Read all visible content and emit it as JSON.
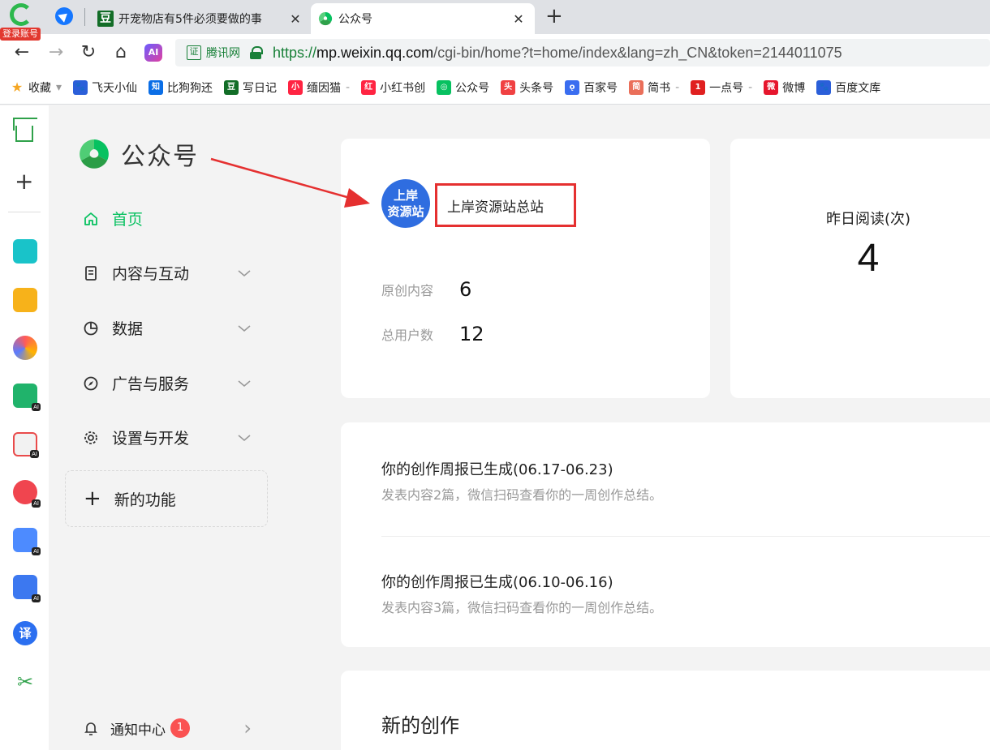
{
  "browser": {
    "brand_badge": "登录账号",
    "tabs": [
      {
        "title": "开宠物店有5件必须要做的事",
        "close": "✕",
        "favicon": "豆"
      },
      {
        "title": "公众号",
        "close": "✕"
      }
    ],
    "new_tab": "+",
    "nav": {
      "back": "←",
      "forward": "→",
      "reload": "↻",
      "home": "⌂",
      "ai": "AI"
    },
    "address": {
      "cert_icon": "证",
      "cert_label": "腾讯网",
      "scheme": "https://",
      "host": "mp.weixin.qq.com",
      "path": "/cgi-bin/home?t=home/index&lang=zh_CN&token=2144011075"
    },
    "bookmarks": [
      {
        "label": "收藏",
        "icon": "★",
        "color": "#f5a623",
        "suffix": "▾"
      },
      {
        "label": "飞天小仙",
        "icon": "🐾",
        "color": "#2b5fd9"
      },
      {
        "label": "比狗狗还",
        "icon": "知",
        "color": "#0b6ee6"
      },
      {
        "label": "写日记",
        "icon": "豆",
        "color": "#126d27"
      },
      {
        "label": "缅因猫",
        "icon": "小",
        "color": "#ff2442",
        "suffix": "-"
      },
      {
        "label": "小红书创",
        "icon": "红",
        "color": "#ff2442"
      },
      {
        "label": "公众号",
        "icon": "◎",
        "color": "#07c160"
      },
      {
        "label": "头条号",
        "icon": "头",
        "color": "#f04142"
      },
      {
        "label": "百家号",
        "icon": "ǫ",
        "color": "#3a6df0"
      },
      {
        "label": "简书",
        "icon": "简",
        "color": "#ea6f5a",
        "suffix": "-"
      },
      {
        "label": "一点号",
        "icon": "1",
        "color": "#e02020",
        "suffix": "-"
      },
      {
        "label": "微博",
        "icon": "微",
        "color": "#e6162d"
      },
      {
        "label": "百度文库",
        "icon": "🐾",
        "color": "#2b5fd9"
      }
    ]
  },
  "sidebar": {
    "logo_text": "公众号",
    "menu": [
      {
        "label": "首页",
        "active": true
      },
      {
        "label": "内容与互动",
        "chevron": "⌄"
      },
      {
        "label": "数据",
        "chevron": "⌄"
      },
      {
        "label": "广告与服务",
        "chevron": "⌄"
      },
      {
        "label": "设置与开发",
        "chevron": "⌄"
      }
    ],
    "new_features": {
      "plus": "+",
      "label": "新的功能"
    },
    "notifications": {
      "label": "通知中心",
      "count": "1",
      "chevron": "›"
    }
  },
  "account": {
    "avatar_text_1": "上岸",
    "avatar_text_2": "资源站",
    "name": "上岸资源站总站",
    "stats": [
      {
        "label": "原创内容",
        "value": "6"
      },
      {
        "label": "总用户数",
        "value": "12"
      }
    ]
  },
  "reads": {
    "label": "昨日阅读(次)",
    "value": "4"
  },
  "weekly_reports": [
    {
      "title": "你的创作周报已生成(06.17-06.23)",
      "desc": "发表内容2篇，微信扫码查看你的一周创作总结。"
    },
    {
      "title": "你的创作周报已生成(06.10-06.16)",
      "desc": "发表内容3篇，微信扫码查看你的一周创作总结。"
    }
  ],
  "new_creation": {
    "title": "新的创作"
  },
  "colors": {
    "accent": "#07c160",
    "highlight_box": "#e53030",
    "arrow": "#e53030",
    "badge": "#fa5151"
  }
}
